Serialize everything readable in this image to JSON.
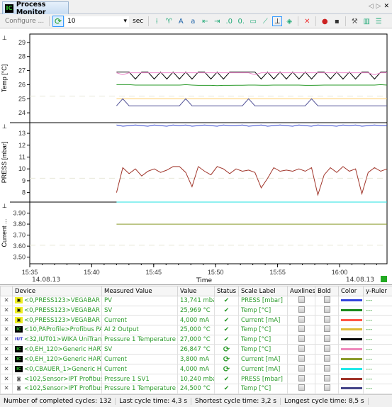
{
  "window": {
    "tab_title": "Process Monitor",
    "logo_text": "ICS"
  },
  "toolbar": {
    "configure_label": "Configure ...",
    "interval_value": "10",
    "interval_unit": "sec",
    "icons": [
      "axis-icon",
      "marker-icon",
      "font-a-icon",
      "font-a-small-icon",
      "go-start-icon",
      "go-end-icon",
      "decimal-more-icon",
      "decimal-less-icon",
      "folder-icon",
      "ruler-icon",
      "pin-icon",
      "shapes-icon",
      "delete-series-icon",
      "record-icon",
      "save-icon",
      "wrench-icon",
      "book-icon",
      "notes-icon"
    ]
  },
  "chart_data": {
    "type": "line",
    "xlabel": "Time",
    "x_ticks": [
      "15:35",
      "15:40",
      "15:45",
      "15:50",
      "15:55",
      "16:00"
    ],
    "x_date_left": "14.08.13",
    "x_date_right": "14.08.13",
    "x_start": "15:42",
    "x_end": "16:03:50",
    "panels": [
      {
        "ylabel": "Temp [°C]",
        "ylim": [
          23.3,
          29.6
        ],
        "ticks": [
          "29",
          "28",
          "27",
          "26",
          "25",
          "24"
        ]
      },
      {
        "ylabel": "PRESS [mbar]",
        "ylim": [
          7.2,
          13.9
        ],
        "ticks": [
          "13",
          "12",
          "11",
          "10",
          "9",
          "8"
        ]
      },
      {
        "ylabel": "Current ...",
        "ylim": [
          3.44,
          4.0
        ],
        "ticks": [
          "3.90",
          "3.80",
          "3.70",
          "3.60",
          "3.50"
        ]
      }
    ],
    "series": [
      {
        "panel": 0,
        "color": "#000000",
        "values": [
          26.9,
          26.9,
          26.9,
          26.4,
          26.9,
          26.9,
          26.4,
          26.9,
          26.4,
          26.9,
          26.4,
          26.9,
          26.4,
          26.9,
          26.9,
          26.4,
          26.9,
          26.4,
          26.9,
          26.9,
          26.9,
          26.9,
          26.9,
          26.4,
          26.9,
          26.4,
          26.9,
          26.4,
          26.9,
          26.4,
          26.9,
          26.4,
          26.9,
          26.9,
          26.4,
          26.9,
          26.4,
          26.9,
          26.4,
          26.9,
          26.9,
          26.4,
          26.9,
          26.9
        ]
      },
      {
        "panel": 0,
        "color": "#ee88cc",
        "values": [
          26.85,
          26.7,
          26.85,
          26.85,
          26.85,
          26.85,
          26.85,
          26.85,
          26.85,
          26.85,
          26.85,
          26.85,
          26.85,
          26.85,
          26.85,
          26.85,
          26.85,
          26.85,
          26.85,
          26.85,
          26.85,
          26.85,
          26.7,
          26.85,
          26.85,
          26.85,
          26.85,
          26.85,
          26.85,
          26.85,
          26.85,
          26.85,
          26.85,
          26.85,
          26.85,
          26.85,
          26.85,
          26.85,
          26.85,
          26.85,
          26.85,
          26.7,
          26.85,
          26.85
        ]
      },
      {
        "panel": 0,
        "color": "#2a9a2a",
        "values": [
          26.0,
          26.0,
          26.0,
          25.97,
          25.97,
          25.97,
          25.97,
          25.97,
          25.97,
          25.97,
          25.97,
          26.0,
          25.97,
          25.95,
          25.95,
          25.95,
          25.93,
          25.95,
          25.95,
          25.96,
          25.96,
          25.97,
          25.97,
          25.96,
          25.96,
          25.97,
          25.97,
          25.97,
          25.97,
          25.97,
          25.95,
          25.95,
          25.96,
          25.97,
          25.97,
          25.97,
          25.97,
          25.97,
          25.97,
          25.97,
          25.97,
          25.97,
          26.0,
          25.97
        ]
      },
      {
        "panel": 0,
        "color": "#ffcc66",
        "values": [
          25.0,
          25.0,
          25.0,
          25.0,
          25.0,
          25.0,
          25.0,
          25.0,
          25.0,
          25.0,
          25.0,
          25.0,
          25.0,
          25.0,
          25.0,
          25.0,
          25.0,
          25.0,
          25.0,
          25.0,
          25.0,
          25.0,
          25.0,
          25.0,
          25.0,
          25.0,
          25.0,
          25.0,
          25.0,
          25.0,
          25.0,
          25.0,
          25.0,
          25.0,
          25.0,
          25.0,
          25.0,
          25.0,
          25.0,
          25.0,
          25.0,
          25.0,
          25.0,
          25.0
        ]
      },
      {
        "panel": 0,
        "color": "#555599",
        "values": [
          24.5,
          25.0,
          24.5,
          24.5,
          24.5,
          24.5,
          24.5,
          24.5,
          24.5,
          24.5,
          24.5,
          25.0,
          24.5,
          24.5,
          24.5,
          24.5,
          24.5,
          24.5,
          24.5,
          24.5,
          24.5,
          25.0,
          24.5,
          24.5,
          24.5,
          24.5,
          24.5,
          24.5,
          24.5,
          24.5,
          24.5,
          25.0,
          24.5,
          24.5,
          24.5,
          24.5,
          24.5,
          24.5,
          24.5,
          24.5,
          24.5,
          24.5,
          24.5,
          24.5
        ]
      },
      {
        "panel": 1,
        "color": "#3344cc",
        "values": [
          13.7,
          13.6,
          13.65,
          13.7,
          13.65,
          13.6,
          13.7,
          13.65,
          13.6,
          13.7,
          13.65,
          13.7,
          13.6,
          13.65,
          13.7,
          13.65,
          13.6,
          13.7,
          13.65,
          13.65,
          13.7,
          13.6,
          13.65,
          13.7,
          13.6,
          13.65,
          13.7,
          13.65,
          13.6,
          13.7,
          13.65,
          13.6,
          13.7,
          13.65,
          13.65,
          13.6,
          13.7,
          13.65,
          13.7,
          13.6,
          13.65,
          13.7,
          13.65,
          13.65
        ]
      },
      {
        "panel": 1,
        "color": "#a0352a",
        "values": [
          8.0,
          10.1,
          9.6,
          10.0,
          9.4,
          9.8,
          10.0,
          9.7,
          9.9,
          10.2,
          10.2,
          9.7,
          8.5,
          10.2,
          9.8,
          9.5,
          10.2,
          10.0,
          9.6,
          10.0,
          9.8,
          9.9,
          9.7,
          8.4,
          9.2,
          10.1,
          9.8,
          9.9,
          9.8,
          10.0,
          9.8,
          10.1,
          7.8,
          9.5,
          10.1,
          9.7,
          10.2,
          9.8,
          10.0,
          7.9,
          9.7,
          10.1,
          9.8,
          10.0
        ]
      },
      {
        "panel": 2,
        "color": "#22e0e0",
        "values": [
          4.0,
          4.0,
          4.0,
          4.0,
          4.0,
          4.0,
          4.0,
          4.0,
          4.0,
          4.0,
          4.0,
          4.0,
          4.0,
          4.0,
          4.0,
          4.0,
          4.0,
          4.0,
          4.0,
          4.0,
          4.0,
          4.0,
          4.0,
          4.0,
          4.0,
          4.0,
          4.0,
          4.0,
          4.0,
          4.0,
          4.0,
          4.0,
          4.0,
          4.0,
          4.0,
          4.0,
          4.0,
          4.0,
          4.0,
          4.0,
          4.0,
          4.0,
          4.0,
          4.0
        ]
      },
      {
        "panel": 2,
        "color": "#8a9a2a",
        "values": [
          3.8,
          3.8,
          3.8,
          3.8,
          3.8,
          3.8,
          3.8,
          3.8,
          3.8,
          3.8,
          3.8,
          3.8,
          3.8,
          3.8,
          3.8,
          3.8,
          3.8,
          3.8,
          3.8,
          3.8,
          3.8,
          3.8,
          3.8,
          3.8,
          3.8,
          3.8,
          3.8,
          3.8,
          3.8,
          3.8,
          3.8,
          3.8,
          3.8,
          3.8,
          3.8,
          3.8,
          3.8,
          3.8,
          3.8,
          3.8,
          3.8,
          3.8,
          3.8,
          3.8
        ]
      }
    ]
  },
  "table": {
    "headers": [
      "",
      "Device",
      "Measured Value",
      "Value",
      "Status",
      "Scale Label",
      "Auxlines",
      "Bold",
      "Color",
      "y-Ruler"
    ],
    "rows": [
      {
        "device": "<0,PRESS123>VEGABAR 6",
        "measured": "PV",
        "value": "13,741 mbar",
        "status": "ok",
        "scale": "PRESS [mbar]",
        "color": "#3344dd",
        "ruler": "---",
        "icon": "vega"
      },
      {
        "device": "<0,PRESS123>VEGABAR 6",
        "measured": "SV",
        "value": "25,969 °C",
        "status": "ok",
        "scale": "Temp [°C]",
        "color": "#1a8a1a",
        "ruler": "---",
        "icon": "vega"
      },
      {
        "device": "<0,PRESS123>VEGABAR 6",
        "measured": "Current",
        "value": "4,000 mA",
        "status": "ok",
        "scale": "Current [mA]",
        "color": "#ff5544",
        "ruler": "---",
        "icon": "vega"
      },
      {
        "device": "<10,PAProfile>Profibus PA",
        "measured": "AI 2 Output",
        "value": "25,000 °C",
        "status": "ok",
        "scale": "Temp [°C]",
        "color": "#ddbb33",
        "ruler": "---",
        "icon": "ics"
      },
      {
        "device": "<32,IUT01>WIKA UniTrans",
        "measured": "Pressure 1 Temperature",
        "value": "27,000 °C",
        "status": "ok",
        "scale": "Temp [°C]",
        "color": "#000000",
        "ruler": "---",
        "icon": "iut"
      },
      {
        "device": "<0,EH_120>Generic HART",
        "measured": "SV",
        "value": "26,847 °C",
        "status": "sync",
        "scale": "Temp [°C]",
        "color": "#ee88bb",
        "ruler": "---",
        "icon": "ics"
      },
      {
        "device": "<0,EH_120>Generic HART",
        "measured": "Current",
        "value": "3,800 mA",
        "status": "sync",
        "scale": "Current [mA]",
        "color": "#8a9a2a",
        "ruler": "---",
        "icon": "ics"
      },
      {
        "device": "<0,CBAUER_1>Generic HA",
        "measured": "Current",
        "value": "4,000 mA",
        "status": "sync",
        "scale": "Current [mA]",
        "color": "#22e8e8",
        "ruler": "---",
        "icon": "ics"
      },
      {
        "device": "<102,Sensor>IPT Profibus",
        "measured": "Pressure 1 SV1",
        "value": "10,240 mbar",
        "status": "ok",
        "scale": "PRESS [mbar]",
        "color": "#a0352a",
        "ruler": "---",
        "icon": "sensor"
      },
      {
        "device": "<102,Sensor>IPT Profibus",
        "measured": "Pressure 1 Temperature",
        "value": "24,500 °C",
        "status": "ok",
        "scale": "Temp [°C]",
        "color": "#444488",
        "ruler": "---",
        "icon": "sensor"
      }
    ]
  },
  "statusbar": {
    "completed": "Number of completed cycles: 132",
    "last": "Last cycle time: 4,3 s",
    "shortest": "Shortest cycle time: 3,2 s",
    "longest": "Longest cycle time: 8,5 s"
  }
}
